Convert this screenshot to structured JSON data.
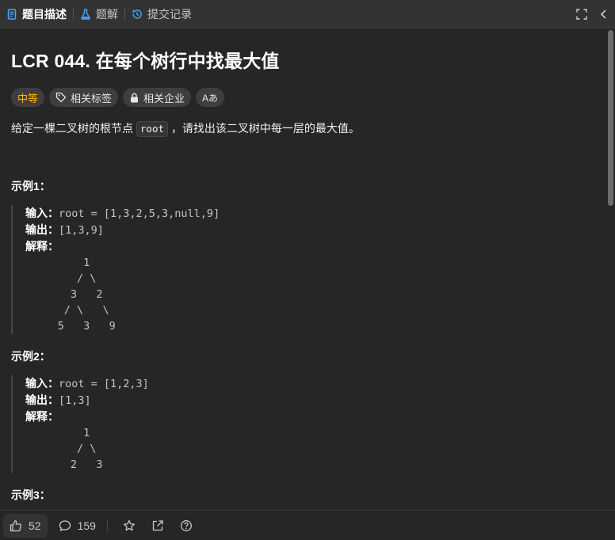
{
  "tabs": [
    {
      "label": "题目描述",
      "icon": "document-icon"
    },
    {
      "label": "题解",
      "icon": "flask-icon"
    },
    {
      "label": "提交记录",
      "icon": "history-icon"
    }
  ],
  "problem": {
    "title": "LCR 044. 在每个树行中找最大值",
    "tags": {
      "difficulty": "中等",
      "related_tags": "相关标签",
      "related_companies": "相关企业",
      "translate": "Aあ"
    },
    "description_before": "给定一棵二叉树的根节点 ",
    "description_code": "root",
    "description_after": " ，请找出该二叉树中每一层的最大值。"
  },
  "examples": [
    {
      "title": "示例1：",
      "input_label": "输入：",
      "input": "root = [1,3,2,5,3,null,9]",
      "output_label": "输出：",
      "output": "[1,3,9]",
      "explain_label": "解释：",
      "tree": "         1\n        / \\\n       3   2\n      / \\   \\\n     5   3   9"
    },
    {
      "title": "示例2：",
      "input_label": "输入：",
      "input": "root = [1,2,3]",
      "output_label": "输出：",
      "output": "[1,3]",
      "explain_label": "解释：",
      "tree": "         1\n        / \\\n       2   3"
    },
    {
      "title": "示例3："
    }
  ],
  "bottom": {
    "likes": "52",
    "comments": "159"
  }
}
